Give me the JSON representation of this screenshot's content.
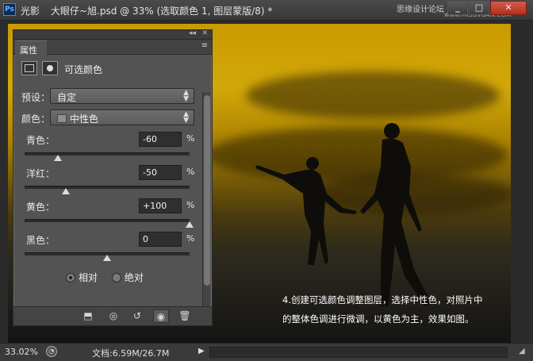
{
  "titlebar": {
    "app_logo": "Ps",
    "app_name": "光影",
    "doc_title": "大眼仔~旭.psd @ 33% (选取颜色 1, 图层蒙版/8) *",
    "watermark": "思缘设计论坛",
    "watermark_url": "www.MISSVUAN.COM",
    "min_label": "_",
    "max_label": "□",
    "close_label": "✕"
  },
  "panel": {
    "collapse_label": "◂◂",
    "close_label": "✕",
    "tab_label": "属性",
    "menu_icon": "≡",
    "adjustment_name": "可选颜色",
    "preset_label": "预设：",
    "preset_value": "自定",
    "colors_label": "颜色：",
    "colors_value": "中性色",
    "sliders": [
      {
        "label": "青色：",
        "value": "-60",
        "unit": "%",
        "level": -60
      },
      {
        "label": "洋红：",
        "value": "-50",
        "unit": "%",
        "level": -50
      },
      {
        "label": "黄色：",
        "value": "+100",
        "unit": "%",
        "level": 100
      },
      {
        "label": "黑色：",
        "value": "0",
        "unit": "%",
        "level": 0
      }
    ],
    "radio_relative": "相对",
    "radio_absolute": "绝对",
    "radio_selected": "相对",
    "footer_icons": [
      "clip-to-layer-icon",
      "view-previous-icon",
      "reset-icon",
      "visibility-icon",
      "trash-icon"
    ]
  },
  "canvas": {
    "caption_line1": "4.创建可选颜色调整图层，选择中性色，对照片中",
    "caption_line2": "的整体色调进行微调，以黄色为主，效果如图。"
  },
  "statusbar": {
    "zoom": "33.02%",
    "doc_info": "文档:6.59M/26.7M",
    "arrow": "▶"
  }
}
